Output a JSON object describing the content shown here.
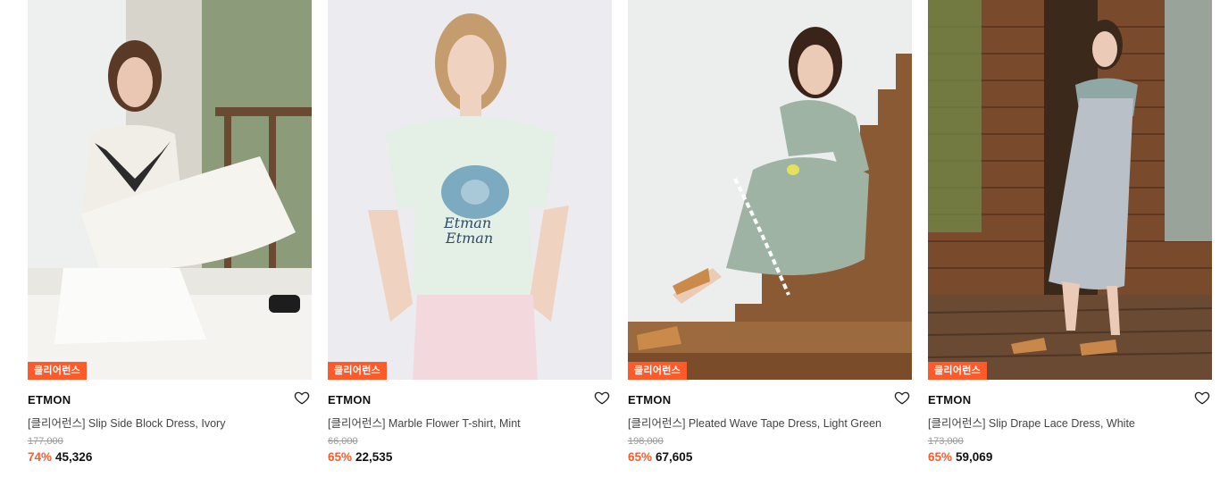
{
  "products": [
    {
      "badge": "클리어런스",
      "brand": "ETMON",
      "name": "[클리어런스] Slip Side Block Dress, Ivory",
      "original_price": "177,000",
      "discount": "74%",
      "price": "45,326",
      "photo": "model-in-ivory-dress-by-window",
      "colors": {
        "bg": "#c9c6bd",
        "garment": "#f1eee8",
        "accent": "#2b2b2b"
      }
    },
    {
      "badge": "클리어런스",
      "brand": "ETMON",
      "name": "[클리어런스] Marble Flower T-shirt, Mint",
      "original_price": "66,000",
      "discount": "65%",
      "price": "22,535",
      "photo": "model-in-mint-tshirt",
      "colors": {
        "bg": "#ecebef",
        "garment": "#e4f0e6",
        "accent": "#6a9db8"
      }
    },
    {
      "badge": "클리어런스",
      "brand": "ETMON",
      "name": "[클리어런스] Pleated Wave Tape Dress, Light Green",
      "original_price": "198,000",
      "discount": "65%",
      "price": "67,605",
      "photo": "model-on-wooden-stairs",
      "colors": {
        "bg": "#8a5a34",
        "garment": "#9fb3a5",
        "accent": "#c98a4a"
      }
    },
    {
      "badge": "클리어런스",
      "brand": "ETMON",
      "name": "[클리어런스] Slip Drape Lace Dress, White",
      "original_price": "173,000",
      "discount": "65%",
      "price": "59,069",
      "photo": "model-by-wooden-cabin",
      "colors": {
        "bg": "#7a4a2c",
        "garment": "#b9c0c8",
        "accent": "#3b2a1c"
      }
    }
  ],
  "theme": {
    "accent": "#ff5a2a",
    "text": "#111111",
    "muted": "#9a9a9a"
  }
}
